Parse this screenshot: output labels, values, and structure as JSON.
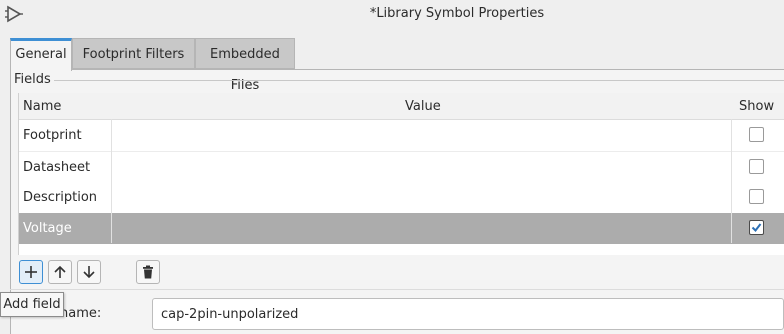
{
  "window": {
    "title": "*Library Symbol Properties"
  },
  "tabs": [
    {
      "label": "General",
      "active": true
    },
    {
      "label": "Footprint Filters",
      "active": false
    },
    {
      "label": "Embedded Files",
      "active": false
    }
  ],
  "fields_group": {
    "label": "Fields",
    "columns": [
      "Name",
      "Value",
      "Show"
    ],
    "rows": [
      {
        "name": "Footprint",
        "value": "",
        "show": false,
        "selected": false
      },
      {
        "name": "Datasheet",
        "value": "",
        "show": false,
        "selected": false
      },
      {
        "name": "Description",
        "value": "",
        "show": false,
        "selected": false
      },
      {
        "name": "Voltage",
        "value": "",
        "show": true,
        "selected": true
      }
    ]
  },
  "toolbar": {
    "add_icon": "plus-icon",
    "up_icon": "arrow-up-icon",
    "down_icon": "arrow-down-icon",
    "delete_icon": "trash-icon"
  },
  "symbol_name": {
    "label": "Symbol name:",
    "visible_label": "name:",
    "value": "cap-2pin-unpolarized"
  },
  "tooltip": {
    "text": "Add field"
  },
  "colors": {
    "accent": "#3e8fd4",
    "selected_row": "#acacac",
    "panel": "#f4f4f4"
  }
}
